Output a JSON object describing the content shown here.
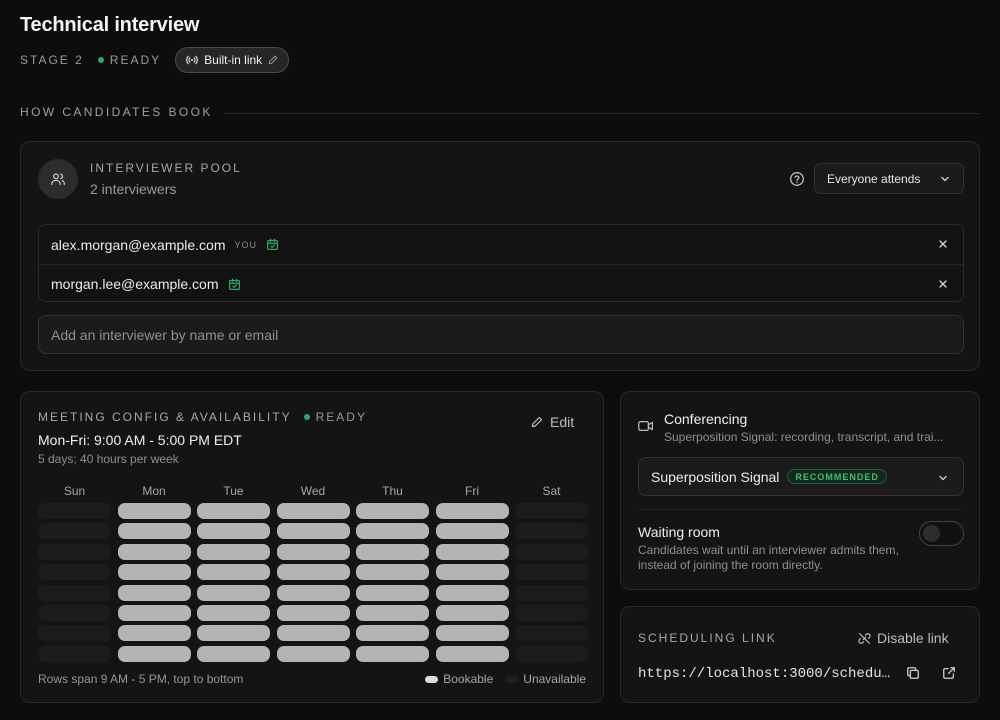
{
  "page": {
    "title": "Technical interview",
    "stage_label": "STAGE 2",
    "status": "READY",
    "link_chip": "Built-in link"
  },
  "section": {
    "heading": "HOW CANDIDATES BOOK"
  },
  "pool": {
    "title": "INTERVIEWER POOL",
    "subtitle": "2 interviewers",
    "attendance_mode": "Everyone attends",
    "interviewers": [
      {
        "email": "alex.morgan@example.com",
        "tag": "YOU"
      },
      {
        "email": "morgan.lee@example.com",
        "tag": ""
      }
    ],
    "add_placeholder": "Add an interviewer by name or email"
  },
  "config": {
    "title": "MEETING CONFIG & AVAILABILITY",
    "status": "READY",
    "edit_label": "Edit",
    "hours": "Mon-Fri: 9:00 AM - 5:00 PM EDT",
    "summary": "5 days; 40 hours per week",
    "days": [
      "Sun",
      "Mon",
      "Tue",
      "Wed",
      "Thu",
      "Fri",
      "Sat"
    ],
    "bookable_days": [
      false,
      true,
      true,
      true,
      true,
      true,
      false
    ],
    "slot_rows": 8,
    "rows_note": "Rows span 9 AM - 5 PM, top to bottom",
    "legend_bookable": "Bookable",
    "legend_unavailable": "Unavailable"
  },
  "conferencing": {
    "title": "Conferencing",
    "description": "Superposition Signal: recording, transcript, and trai...",
    "provider": "Superposition Signal",
    "provider_badge": "RECOMMENDED",
    "waiting_room_title": "Waiting room",
    "waiting_room_desc": "Candidates wait until an interviewer admits them, instead of joining the room directly.",
    "waiting_room_enabled": false
  },
  "scheduling": {
    "title": "SCHEDULING LINK",
    "disable_label": "Disable link",
    "url": "https://localhost:3000/schedu..."
  },
  "colors": {
    "background": "#0d0d0d",
    "card": "#141414",
    "ready_green": "#2fa968",
    "bookable": "#b4b4b4",
    "unavailable": "#1c1c1c"
  }
}
